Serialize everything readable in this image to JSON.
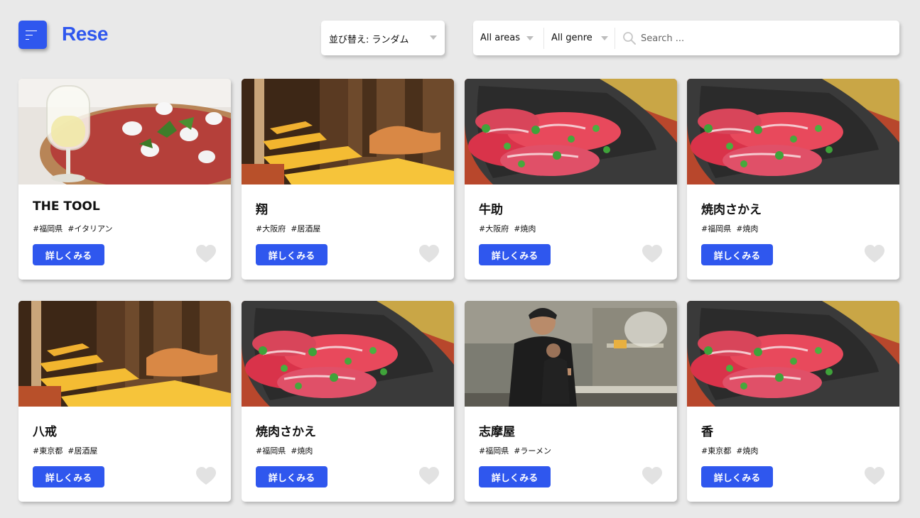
{
  "header": {
    "logo": "Rese",
    "sort": {
      "label": "並び替え: ランダム"
    },
    "area_select": {
      "value": "All areas"
    },
    "genre_select": {
      "value": "All genre"
    },
    "search": {
      "placeholder": "Search ..."
    }
  },
  "detail_label": "詳しくみる",
  "colors": {
    "accent": "#2f57ee",
    "background": "#e9e9e9",
    "heart": "#e2e2e2"
  },
  "shops": [
    {
      "name": "THE TOOL",
      "area": "#福岡県",
      "genre": "#イタリアン",
      "image": "pizza"
    },
    {
      "name": "翔",
      "area": "#大阪府",
      "genre": "#居酒屋",
      "image": "izakaya-interior"
    },
    {
      "name": "牛助",
      "area": "#大阪府",
      "genre": "#焼肉",
      "image": "yakiniku-meat"
    },
    {
      "name": "焼肉さかえ",
      "area": "#福岡県",
      "genre": "#焼肉",
      "image": "yakiniku-meat"
    },
    {
      "name": "八戒",
      "area": "#東京都",
      "genre": "#居酒屋",
      "image": "izakaya-interior"
    },
    {
      "name": "焼肉さかえ",
      "area": "#福岡県",
      "genre": "#焼肉",
      "image": "yakiniku-meat"
    },
    {
      "name": "志摩屋",
      "area": "#福岡県",
      "genre": "#ラーメン",
      "image": "ramen-kitchen"
    },
    {
      "name": "香",
      "area": "#東京都",
      "genre": "#焼肉",
      "image": "yakiniku-meat"
    }
  ]
}
